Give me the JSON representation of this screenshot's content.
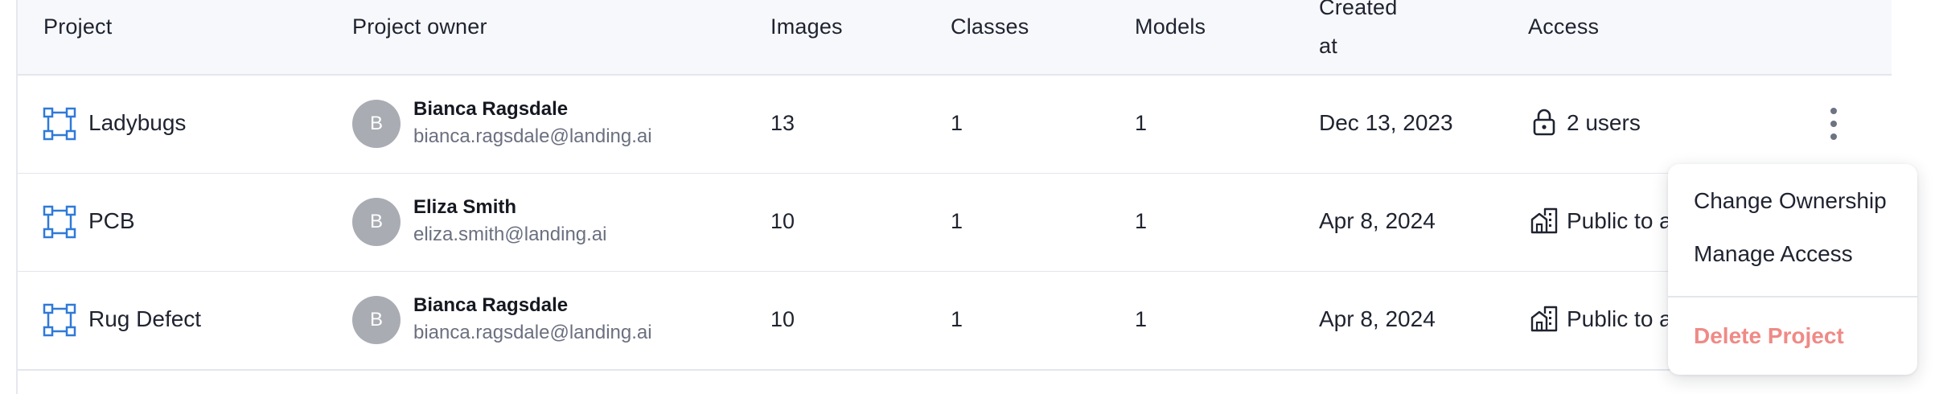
{
  "table": {
    "headers": {
      "project": "Project",
      "owner": "Project owner",
      "images": "Images",
      "classes": "Classes",
      "models": "Models",
      "created_line1": "Created",
      "created_line2": "at",
      "access": "Access"
    },
    "rows": [
      {
        "project": "Ladybugs",
        "owner_initial": "B",
        "owner_name": "Bianca Ragsdale",
        "owner_email": "bianca.ragsdale@landing.ai",
        "images": "13",
        "classes": "1",
        "models": "1",
        "created": "Dec 13, 2023",
        "access": "2 users",
        "access_icon": "lock-icon"
      },
      {
        "project": "PCB",
        "owner_initial": "B",
        "owner_name": "Eliza Smith",
        "owner_email": "eliza.smith@landing.ai",
        "images": "10",
        "classes": "1",
        "models": "1",
        "created": "Apr 8, 2024",
        "access": "Public to a",
        "access_icon": "building-icon"
      },
      {
        "project": "Rug Defect",
        "owner_initial": "B",
        "owner_name": "Bianca Ragsdale",
        "owner_email": "bianca.ragsdale@landing.ai",
        "images": "10",
        "classes": "1",
        "models": "1",
        "created": "Apr 8, 2024",
        "access": "Public to a",
        "access_icon": "building-icon"
      }
    ]
  },
  "menu": {
    "change_ownership": "Change Ownership",
    "manage_access": "Manage Access",
    "delete_project": "Delete Project"
  },
  "colors": {
    "icon_blue": "#2f7ad8",
    "avatar_gray": "#a9acb3",
    "danger": "#ef8a86",
    "header_bg": "#f7f8fb"
  }
}
